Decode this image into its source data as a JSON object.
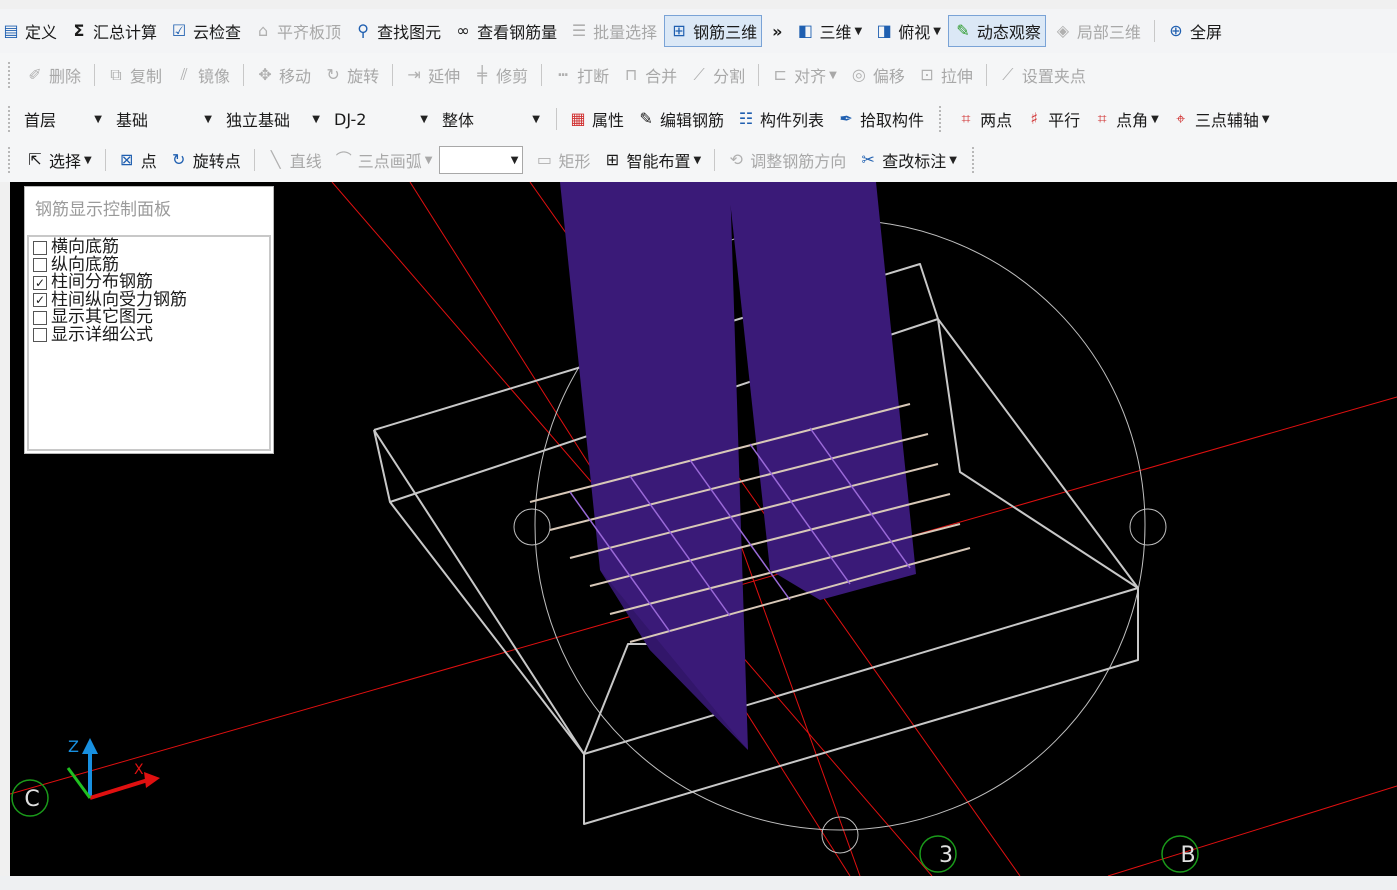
{
  "toolbar1": {
    "items": [
      {
        "label": "定义",
        "icon": "define-icon",
        "glyph": "▤"
      },
      {
        "label": "汇总计算",
        "icon": "sigma-icon",
        "glyph": "Σ"
      },
      {
        "label": "云检查",
        "icon": "cloud-check-icon",
        "glyph": "☑"
      },
      {
        "label": "平齐板顶",
        "icon": "align-slab-icon",
        "glyph": "⌂"
      },
      {
        "label": "查找图元",
        "icon": "binoculars-icon",
        "glyph": "⚲"
      },
      {
        "label": "查看钢筋量",
        "icon": "glasses-icon",
        "glyph": "∞"
      },
      {
        "label": "批量选择",
        "icon": "batch-select-icon",
        "glyph": "☰"
      },
      {
        "label": "钢筋三维",
        "icon": "rebar-3d-icon",
        "glyph": "⊞"
      },
      {
        "label": "三维",
        "icon": "cube-icon",
        "glyph": "◧"
      },
      {
        "label": "俯视",
        "icon": "top-view-icon",
        "glyph": "◨"
      },
      {
        "label": "动态观察",
        "icon": "orbit-icon",
        "glyph": "✎"
      },
      {
        "label": "局部三维",
        "icon": "partial-3d-icon",
        "glyph": "◈"
      },
      {
        "label": "全屏",
        "icon": "zoom-full-icon",
        "glyph": "⊕"
      }
    ],
    "overflow": "»"
  },
  "toolbar2": {
    "items": [
      {
        "label": "删除",
        "icon": "delete-icon",
        "glyph": "✐"
      },
      {
        "label": "复制",
        "icon": "copy-icon",
        "glyph": "⧉"
      },
      {
        "label": "镜像",
        "icon": "mirror-icon",
        "glyph": "⫽"
      },
      {
        "label": "移动",
        "icon": "move-icon",
        "glyph": "✥"
      },
      {
        "label": "旋转",
        "icon": "rotate-icon",
        "glyph": "↻"
      },
      {
        "label": "延伸",
        "icon": "extend-icon",
        "glyph": "⇥"
      },
      {
        "label": "修剪",
        "icon": "trim-icon",
        "glyph": "╪"
      },
      {
        "label": "打断",
        "icon": "break-icon",
        "glyph": "┅"
      },
      {
        "label": "合并",
        "icon": "merge-icon",
        "glyph": "⊓"
      },
      {
        "label": "分割",
        "icon": "split-icon",
        "glyph": "⟋"
      },
      {
        "label": "对齐",
        "icon": "align-icon",
        "glyph": "⊏"
      },
      {
        "label": "偏移",
        "icon": "offset-icon",
        "glyph": "◎"
      },
      {
        "label": "拉伸",
        "icon": "stretch-icon",
        "glyph": "⊡"
      },
      {
        "label": "设置夹点",
        "icon": "grip-icon",
        "glyph": "⟋"
      }
    ]
  },
  "toolbar3": {
    "floor": "首层",
    "category": "基础",
    "type": "独立基础",
    "component": "DJ-2",
    "scope": "整体",
    "items": [
      {
        "label": "属性",
        "icon": "properties-icon",
        "glyph": "▦"
      },
      {
        "label": "编辑钢筋",
        "icon": "edit-rebar-icon",
        "glyph": "✎"
      },
      {
        "label": "构件列表",
        "icon": "list-icon",
        "glyph": "☷"
      },
      {
        "label": "拾取构件",
        "icon": "pick-icon",
        "glyph": "✒"
      },
      {
        "label": "两点",
        "icon": "two-point-icon",
        "glyph": "⌗"
      },
      {
        "label": "平行",
        "icon": "parallel-icon",
        "glyph": "♯"
      },
      {
        "label": "点角",
        "icon": "point-angle-icon",
        "glyph": "⌗"
      },
      {
        "label": "三点辅轴",
        "icon": "three-point-axis-icon",
        "glyph": "⌖"
      }
    ]
  },
  "toolbar4": {
    "items": [
      {
        "label": "选择",
        "icon": "select-arrow-icon",
        "glyph": "⇱"
      },
      {
        "label": "点",
        "icon": "point-icon",
        "glyph": "⊠"
      },
      {
        "label": "旋转点",
        "icon": "rotate-point-icon",
        "glyph": "↻"
      },
      {
        "label": "直线",
        "icon": "line-icon",
        "glyph": "╲"
      },
      {
        "label": "三点画弧",
        "icon": "arc-icon",
        "glyph": "⌒"
      },
      {
        "label": "矩形",
        "icon": "rectangle-icon",
        "glyph": "▭"
      },
      {
        "label": "智能布置",
        "icon": "smart-layout-icon",
        "glyph": "⊞"
      },
      {
        "label": "调整钢筋方向",
        "icon": "adjust-rebar-direction-icon",
        "glyph": "⟲"
      },
      {
        "label": "查改标注",
        "icon": "annotate-icon",
        "glyph": "✂"
      }
    ]
  },
  "panel": {
    "title": "钢筋显示控制面板",
    "options": [
      {
        "label": "横向底筋",
        "checked": false
      },
      {
        "label": "纵向底筋",
        "checked": false
      },
      {
        "label": "柱间分布钢筋",
        "checked": true
      },
      {
        "label": "柱间纵向受力钢筋",
        "checked": true
      },
      {
        "label": "显示其它图元",
        "checked": false
      },
      {
        "label": "显示详细公式",
        "checked": false
      }
    ]
  },
  "viewport": {
    "axis_labels": {
      "x": "X",
      "z": "Z"
    },
    "grid_labels": [
      "C",
      "3",
      "B"
    ],
    "colors": {
      "background": "#000000",
      "column": "#3a1a78",
      "wireframe": "#c8c8c8",
      "axis_line": "#e01010",
      "grid_bubble": "#1a9a1a"
    }
  }
}
